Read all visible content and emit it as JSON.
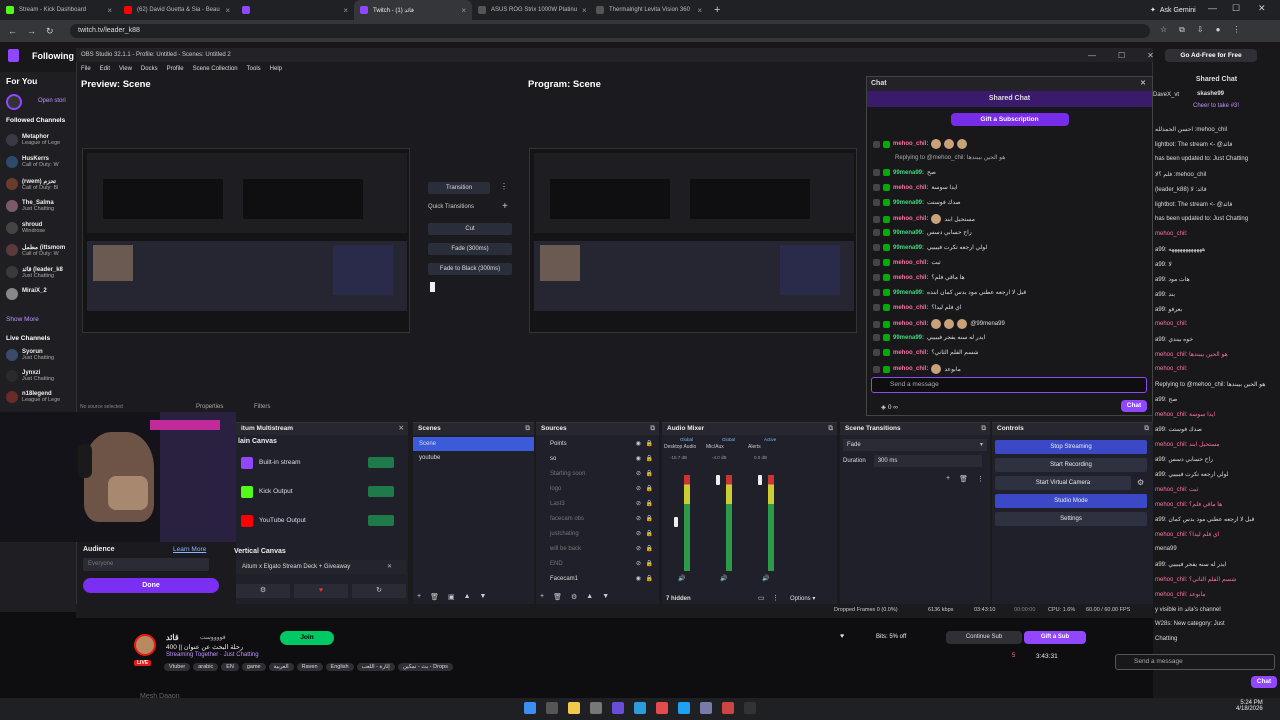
{
  "browser": {
    "tabs": [
      {
        "label": "Stream - Kick Dashboard",
        "color": "#53fc18"
      },
      {
        "label": "(62) David Guetta & Sia - Beau",
        "color": "#ff0000"
      },
      {
        "label": "",
        "color": "#9146ff"
      },
      {
        "label": "Twitch - قائد (1)",
        "color": "#9146ff"
      },
      {
        "label": "ASUS ROG Strix 1000W Platinu",
        "color": "#555555"
      },
      {
        "label": "Thermalright Levita Vision 360",
        "color": "#555555"
      }
    ],
    "gemini": "Ask Gemini",
    "url": "twitch.tv/leader_k88"
  },
  "twitch": {
    "following": "Following",
    "for_you": "For You",
    "open_stories": "Open stori",
    "followed_channels": "Followed Channels",
    "channels": [
      {
        "name": "Metaphor",
        "game": "League of Lege",
        "color": "#3a3a44"
      },
      {
        "name": "HusKerrs",
        "game": "Call of Duty: W",
        "color": "#2d4a6a"
      },
      {
        "name": "(rwem) تحزم",
        "game": "Call of Duty: Bl",
        "color": "#6a3a2a"
      },
      {
        "name": "The_Salma",
        "game": "Just Chatting",
        "color": "#7a5a6a"
      },
      {
        "name": "shroud",
        "game": "Windrose",
        "color": "#444"
      },
      {
        "name": "مطمل (ittsmom",
        "game": "Call of Duty: W",
        "color": "#5a3a3a"
      },
      {
        "name": "قائد (leader_k8",
        "game": "Just Chatting",
        "color": "#3a3a3a"
      },
      {
        "name": "MiraiX_2",
        "game": "",
        "color": "#888"
      }
    ],
    "show_more": "Show More",
    "live_channels": "Live Channels",
    "live": [
      {
        "name": "Syorun",
        "game": "Just Chatting",
        "color": "#3a4a6a"
      },
      {
        "name": "Jynxzi",
        "game": "Just Chatting",
        "color": "#2a2a2a"
      },
      {
        "name": "n18legend",
        "game": "League of Lege",
        "color": "#6a2a2a"
      }
    ]
  },
  "obs": {
    "title": "OBS Studio 32.1.1 - Profile: Untitled - Scenes: Untitled 2",
    "menu": [
      "File",
      "Edit",
      "View",
      "Docks",
      "Profile",
      "Scene Collection",
      "Tools",
      "Help"
    ],
    "preview_title": "Preview: Scene",
    "program_title": "Program: Scene",
    "transition": "Transition",
    "quick_transitions": "Quick Transitions",
    "cut": "Cut",
    "fade": "Fade (300ms)",
    "fade_black": "Fade to Black (300ms)",
    "no_source": "No source selected",
    "properties": "Properties",
    "filters": "Filters",
    "multistream": {
      "title": "itum Multistream",
      "canvas": "lain Canvas",
      "outputs": [
        {
          "label": "Built-in stream",
          "color": "#9146ff"
        },
        {
          "label": "Kick Output",
          "color": "#53fc18"
        },
        {
          "label": "YouTube Output",
          "color": "#ff0000"
        }
      ],
      "audience": "Audience",
      "learn_more": "Learn More",
      "everyone": "Everyone",
      "done": "Done",
      "vertical_canvas": "Vertical Canvas",
      "vertical_item": "Aitum x Elgato Stream Deck + Giveaway"
    },
    "scenes": {
      "title": "Scenes",
      "items": [
        "Scene",
        "youtube"
      ]
    },
    "sources": {
      "title": "Sources",
      "items": [
        {
          "label": "Points",
          "dim": false
        },
        {
          "label": "so",
          "dim": false
        },
        {
          "label": "Starting soon",
          "dim": true
        },
        {
          "label": "logo",
          "dim": true
        },
        {
          "label": "Last3",
          "dim": true
        },
        {
          "label": "facecam obs",
          "dim": true
        },
        {
          "label": "justchating",
          "dim": true
        },
        {
          "label": "will be back",
          "dim": true
        },
        {
          "label": "END",
          "dim": true
        },
        {
          "label": "Facecam1",
          "dim": false
        }
      ]
    },
    "mixer": {
      "title": "Audio Mixer",
      "channels": [
        {
          "tag": "Global",
          "name": "Desktop Audio",
          "db": "-15.7 dB"
        },
        {
          "tag": "Global",
          "name": "Mic/Aux",
          "db": "-4.0 dB"
        },
        {
          "tag": "Active",
          "name": "Alerts",
          "db": "0.0 dB"
        }
      ],
      "hidden": "7 hidden",
      "options": "Options"
    },
    "transitions": {
      "title": "Scene Transitions",
      "type": "Fade",
      "duration_label": "Duration",
      "duration": "300 ms"
    },
    "controls": {
      "title": "Controls",
      "stop_streaming": "Stop Streaming",
      "start_recording": "Start Recording",
      "virtual_camera": "Start Virtual Camera",
      "studio_mode": "Studio Mode",
      "settings": "Settings"
    },
    "status": {
      "dropped": "Dropped Frames 0 (0.0%)",
      "kbps": "6136 kbps",
      "live_time": "03:43:10",
      "rec_time": "00:00:00",
      "cpu": "CPU: 1.6%",
      "fps": "60.00 / 60.00 FPS"
    }
  },
  "chat": {
    "title": "Chat",
    "shared": "Shared Chat",
    "gift": "Gift a Subscription",
    "messages": [
      {
        "user": "mehoo_chil:",
        "text": "",
        "color": "pink",
        "emotes": 3
      },
      {
        "user": "",
        "text": "Replying to @mehoo_chil: هو الحين بيبندها",
        "color": "reply",
        "emotes": 0
      },
      {
        "user": "99mena99:",
        "text": "صح",
        "color": "green",
        "emotes": 0
      },
      {
        "user": "mehoo_chil:",
        "text": "ايدا سوسة",
        "color": "pink",
        "emotes": 0
      },
      {
        "user": "99mena99:",
        "text": "صدك فوستت",
        "color": "green",
        "emotes": 0
      },
      {
        "user": "mehoo_chil:",
        "text": "مستحيل ابند",
        "color": "pink",
        "emotes": 1
      },
      {
        "user": "99mena99:",
        "text": "راح حسابي دسس",
        "color": "green",
        "emotes": 0
      },
      {
        "user": "99mena99:",
        "text": "لولي ارجعه تكرت فيبييي",
        "color": "green",
        "emotes": 0
      },
      {
        "user": "mehoo_chil:",
        "text": "ثبت",
        "color": "pink",
        "emotes": 0
      },
      {
        "user": "mehoo_chil:",
        "text": "ها ماقي فلم؟",
        "color": "pink",
        "emotes": 0
      },
      {
        "user": "99mena99:",
        "text": "قبل لا ارجعه عطني مود بدس كمان ابنده",
        "color": "green",
        "emotes": 0
      },
      {
        "user": "mehoo_chil:",
        "text": "اي فلم ليدا؟",
        "color": "pink",
        "emotes": 0
      },
      {
        "user": "mehoo_chil:",
        "text": "@99mena99",
        "color": "pink",
        "emotes": 3
      },
      {
        "user": "99mena99:",
        "text": "ايدر له سنه يفجر فيبييي",
        "color": "green",
        "emotes": 0
      },
      {
        "user": "mehoo_chil:",
        "text": "شسم الفلم الثاني؟",
        "color": "pink",
        "emotes": 0
      },
      {
        "user": "mehoo_chil:",
        "text": "مابوعد",
        "color": "pink",
        "emotes": 1
      }
    ],
    "placeholder": "Send a message",
    "points": "0",
    "inf": "∞",
    "chat_btn": "Chat"
  },
  "right_chat": {
    "title": "Shared Chat",
    "user_top": "DaveX_vt",
    "skashe": "skashe99",
    "cheer": "Cheer to take #3!",
    "lines": [
      "احسن الحمدلله :mehoo_chil",
      "lightbot: The stream <- @قائد",
      "has been updated to: Just Chatting",
      "فلم ؟لا :mehoo_chil",
      "(leader_k88) قائد: لا",
      "lightbot: The stream <- @قائد",
      "has been updated to: Just Chatting",
      "mehoo_chil:",
      "a99: ههههههههههههه",
      "a99: لا",
      "a99: هات مود",
      "a99: بند",
      "a99: بعرفو",
      "mehoo_chil:",
      "a99: خوه بيندي",
      "mehoo_chil: هو الحين بيبندها",
      "mehoo_chil:",
      "Replying to @mehoo_chil: هو الحين بيبندها",
      "a99: صح",
      "mehoo_chil: ايدا سوسة",
      "a99: صدك فوستت",
      "mehoo_chil: مستحيل ابند",
      "a99: راح حسابي دسس",
      "a99: لولي ارجعه تكرت فيبييي",
      "mehoo_chil: ثبت",
      "mehoo_chil: ها ماقي فلم؟",
      "a99: قبل لا ارجعه عطني مود بدس كمان",
      "mehoo_chil: اي فلم ليدا؟",
      "mena99",
      "a99: ايدر له سنه يفجر فيبييي",
      "mehoo_chil: شسم الفلم الثاني؟",
      "mehoo_chil: مابوعد",
      "y visible in قائد's channel",
      "W28s: New category: Just",
      "Chatting"
    ],
    "placeholder": "Send a message",
    "points": "0",
    "chat_btn": "Chat"
  },
  "stream_info": {
    "name": "قائد",
    "verified": "قووووست",
    "follow": "Join",
    "title": "رحلة البحث عن عنوان || 400",
    "category": "Streaming Together · Just Chatting",
    "tags": [
      "Vtuber",
      "arabic",
      "EN",
      "game",
      "العربية",
      "Raven",
      "English",
      "إثارة - اللعب",
      "بث - تمكين - Drops"
    ],
    "bits": "Bits: 5% off",
    "continue_sub": "Continue Sub",
    "gift_sub": "Gift a Sub",
    "viewers": "5",
    "uptime": "3:43:31",
    "live": "LIVE",
    "bottom_text": "Mesh Daaon"
  },
  "taskbar": {
    "time": "5:24 PM",
    "date": "4/18/2026"
  }
}
